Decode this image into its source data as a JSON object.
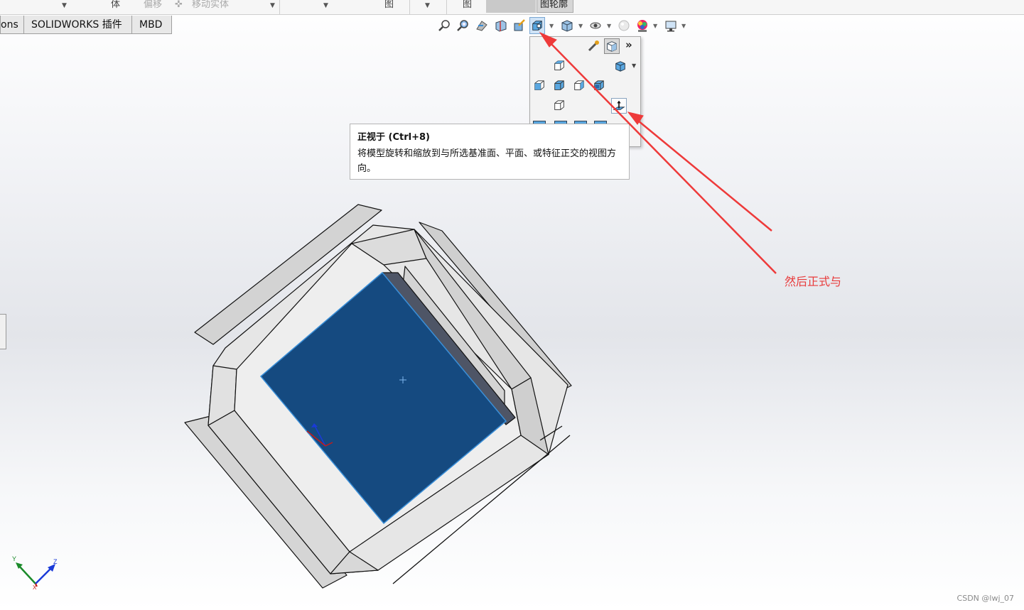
{
  "top_toolbar": {
    "seg_body": "体",
    "seg_offset": "偏移",
    "seg_move_body": "移动实体",
    "seg_view": "图",
    "seg_view2": "图",
    "seg_sketch_outline": "图轮廓"
  },
  "tabs": [
    {
      "label": "ons"
    },
    {
      "label": "SOLIDWORKS 插件"
    },
    {
      "label": "MBD"
    }
  ],
  "hud_icons": [
    "zoom-to-fit-icon",
    "zoom-to-area-icon",
    "previous-view-icon",
    "section-view-icon",
    "dynamic-annotation-icon",
    "view-orientation-icon",
    "display-style-icon",
    "hide-show-icon",
    "edit-appearance-icon",
    "apply-scene-icon",
    "view-settings-icon"
  ],
  "tooltip": {
    "title": "正视于  (Ctrl+8)",
    "body": "将模型旋转和缩放到与所选基准面、平面、或特征正交的视图方向。"
  },
  "flyout": {
    "more_label": "»"
  },
  "annotation": {
    "text": "然后正式与",
    "color": "#e83b3b"
  },
  "watermark": "CSDN @lwj_07",
  "colors": {
    "selected_face": "#154a80",
    "accent": "#3a8fd8"
  }
}
